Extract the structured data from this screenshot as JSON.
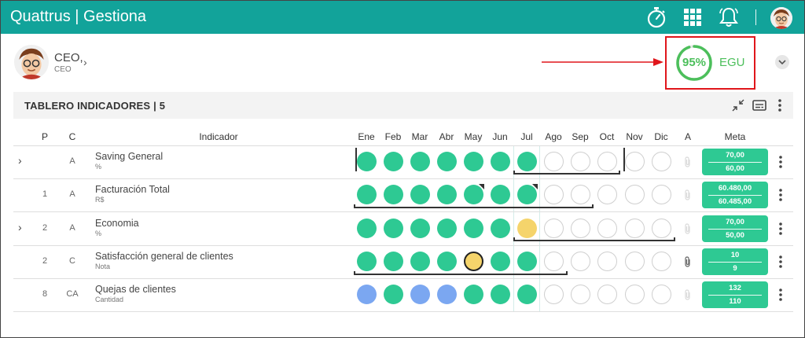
{
  "app": {
    "brand": "Quattrus | Gestiona"
  },
  "topbar": {
    "icons": [
      "stopwatch-icon",
      "apps-grid-icon",
      "bell-icon",
      "user-avatar"
    ]
  },
  "user": {
    "name": "CEO,",
    "role": "CEO"
  },
  "egu": {
    "percent": "95%",
    "label": "EGU",
    "value": 95,
    "color": "#4cbf5b"
  },
  "panel": {
    "title": "TABLERO INDICADORES | 5"
  },
  "columns": {
    "p": "P",
    "c": "C",
    "indicador": "Indicador",
    "months": [
      "Ene",
      "Feb",
      "Mar",
      "Abr",
      "May",
      "Jun",
      "Jul",
      "Ago",
      "Sep",
      "Oct",
      "Nov",
      "Dic"
    ],
    "a": "A",
    "meta": "Meta"
  },
  "colors": {
    "brand": "#12a39a",
    "green": "#2ec993",
    "blue": "#7ba7f1",
    "yellow": "#f5d46b",
    "highlight": "#e0161b"
  },
  "rows": [
    {
      "expandable": true,
      "p": "",
      "c": "A",
      "name": "Saving General",
      "unit": "%",
      "statuses": [
        "green",
        "green",
        "green",
        "green",
        "green",
        "green",
        "green",
        "empty",
        "empty",
        "empty",
        "empty",
        "empty"
      ],
      "meta1": "70,00",
      "meta2": "60,00"
    },
    {
      "expandable": false,
      "p": "1",
      "c": "A",
      "name": "Facturación Total",
      "unit": "R$",
      "statuses": [
        "green",
        "green",
        "green",
        "green",
        "green",
        "green",
        "green",
        "empty",
        "empty",
        "empty",
        "empty",
        "empty"
      ],
      "meta1": "60.480,00",
      "meta2": "60.485,00"
    },
    {
      "expandable": true,
      "p": "2",
      "c": "A",
      "name": "Economia",
      "unit": "%",
      "statuses": [
        "green",
        "green",
        "green",
        "green",
        "green",
        "green",
        "yellow",
        "empty",
        "empty",
        "empty",
        "empty",
        "empty"
      ],
      "meta1": "70,00",
      "meta2": "50,00"
    },
    {
      "expandable": false,
      "p": "2",
      "c": "C",
      "name": "Satisfacción general de clientes",
      "unit": "Nota",
      "statuses": [
        "green",
        "green",
        "green",
        "green",
        "yellow",
        "green",
        "green",
        "empty",
        "empty",
        "empty",
        "empty",
        "empty"
      ],
      "meta1": "10",
      "meta2": "9"
    },
    {
      "expandable": false,
      "p": "8",
      "c": "CA",
      "name": "Quejas de clientes",
      "unit": "Cantidad",
      "statuses": [
        "blue",
        "green",
        "blue",
        "blue",
        "green",
        "green",
        "green",
        "empty",
        "empty",
        "empty",
        "empty",
        "empty"
      ],
      "meta1": "132",
      "meta2": "110"
    }
  ]
}
